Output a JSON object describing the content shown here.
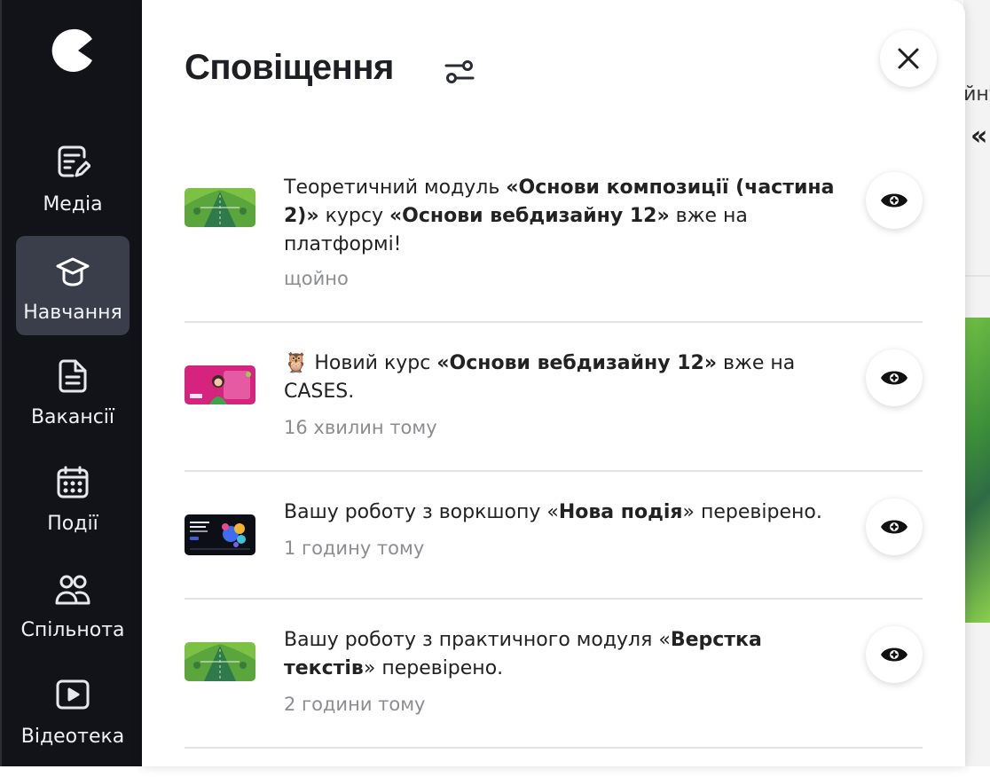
{
  "sidebar": {
    "items": [
      {
        "label": "Медіа",
        "icon": "media-edit-icon"
      },
      {
        "label": "Навчання",
        "icon": "graduation-cap-icon",
        "active": true
      },
      {
        "label": "Вакансії",
        "icon": "document-icon"
      },
      {
        "label": "Події",
        "icon": "calendar-icon"
      },
      {
        "label": "Спільнота",
        "icon": "people-icon"
      },
      {
        "label": "Відеотека",
        "icon": "video-play-icon"
      }
    ]
  },
  "panel": {
    "title": "Сповіщення",
    "filter_icon": "settings-sliders-icon",
    "close_icon": "close-icon"
  },
  "notifications": [
    {
      "parts": [
        {
          "t": "Теоретичний модуль "
        },
        {
          "t": "«Основи композиції (частина 2)»",
          "b": true
        },
        {
          "t": " курсу "
        },
        {
          "t": "«Основи вебдизайну 12»",
          "b": true
        },
        {
          "t": " вже на платформі!"
        }
      ],
      "time": "щойно",
      "thumb": "green-course"
    },
    {
      "parts": [
        {
          "t": "🦉 Новий курс "
        },
        {
          "t": "«Основи вебдизайну 12»",
          "b": true
        },
        {
          "t": " вже на CASES."
        }
      ],
      "time": "16 хвилин тому",
      "thumb": "pink-course"
    },
    {
      "parts": [
        {
          "t": "Вашу роботу з воркшопу «"
        },
        {
          "t": "Нова подія",
          "b": true
        },
        {
          "t": "» перевірено."
        }
      ],
      "time": "1 годину тому",
      "thumb": "dark-event"
    },
    {
      "parts": [
        {
          "t": "Вашу роботу з практичного модуля «"
        },
        {
          "t": "Верстка текстів",
          "b": true
        },
        {
          "t": "» перевірено."
        }
      ],
      "time": "2 години тому",
      "thumb": "green-course"
    }
  ],
  "background": {
    "text_fragment_1": "ійну",
    "text_fragment_2": "«"
  },
  "colors": {
    "sidebar_bg": "#111318",
    "sidebar_active": "#3a3d4a",
    "text_primary": "#222222",
    "text_muted": "#8b8d93"
  }
}
